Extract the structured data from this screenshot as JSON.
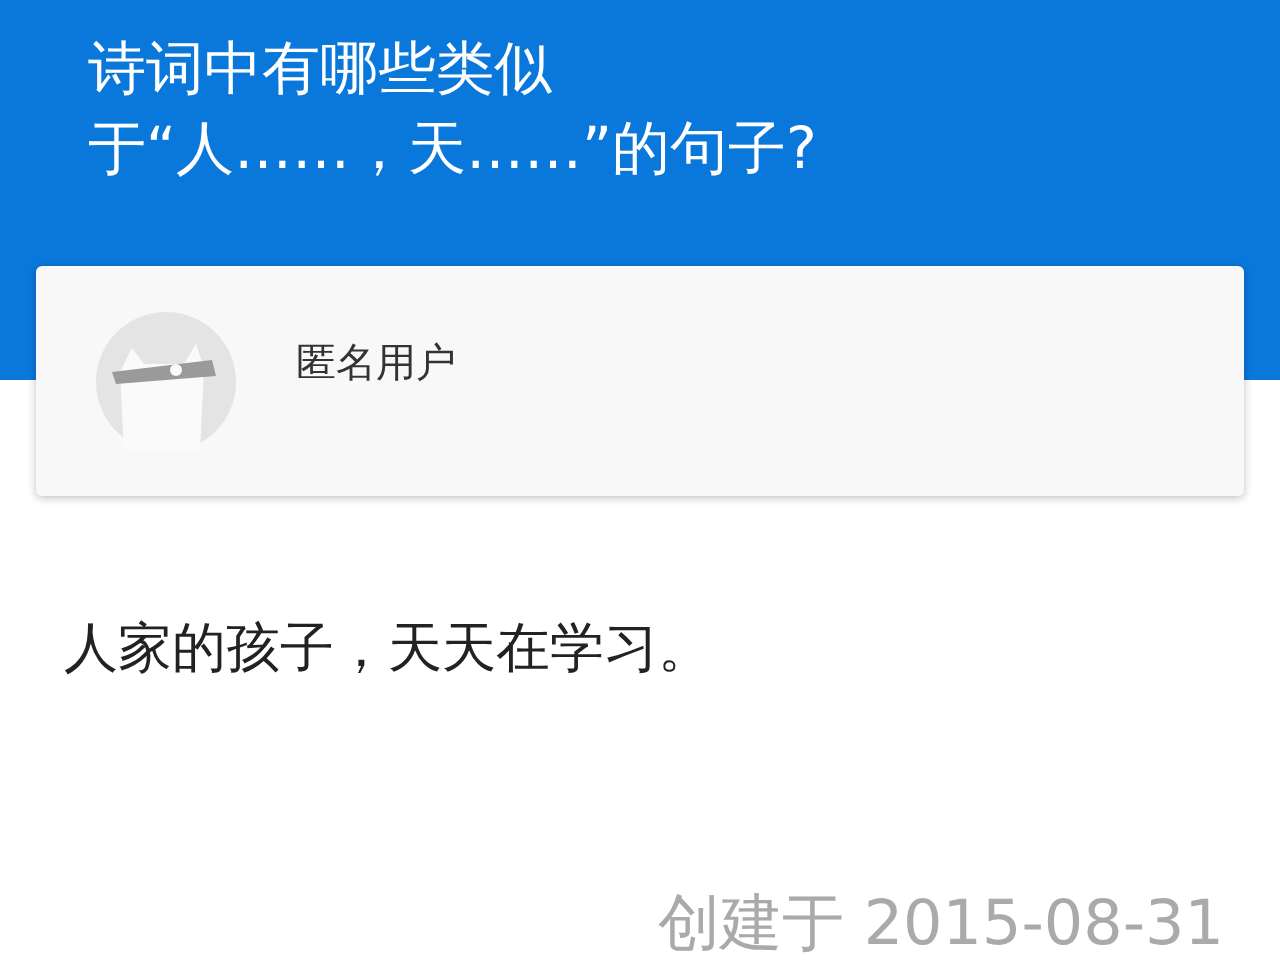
{
  "question": {
    "title_lines": [
      "诗词中有哪些类似",
      "于“人……，天……”的句子?"
    ]
  },
  "author": {
    "name": "匿名用户"
  },
  "answer": {
    "text": "人家的孩子，天天在学习。"
  },
  "footer": {
    "created": "创建于 2015-08-31"
  }
}
